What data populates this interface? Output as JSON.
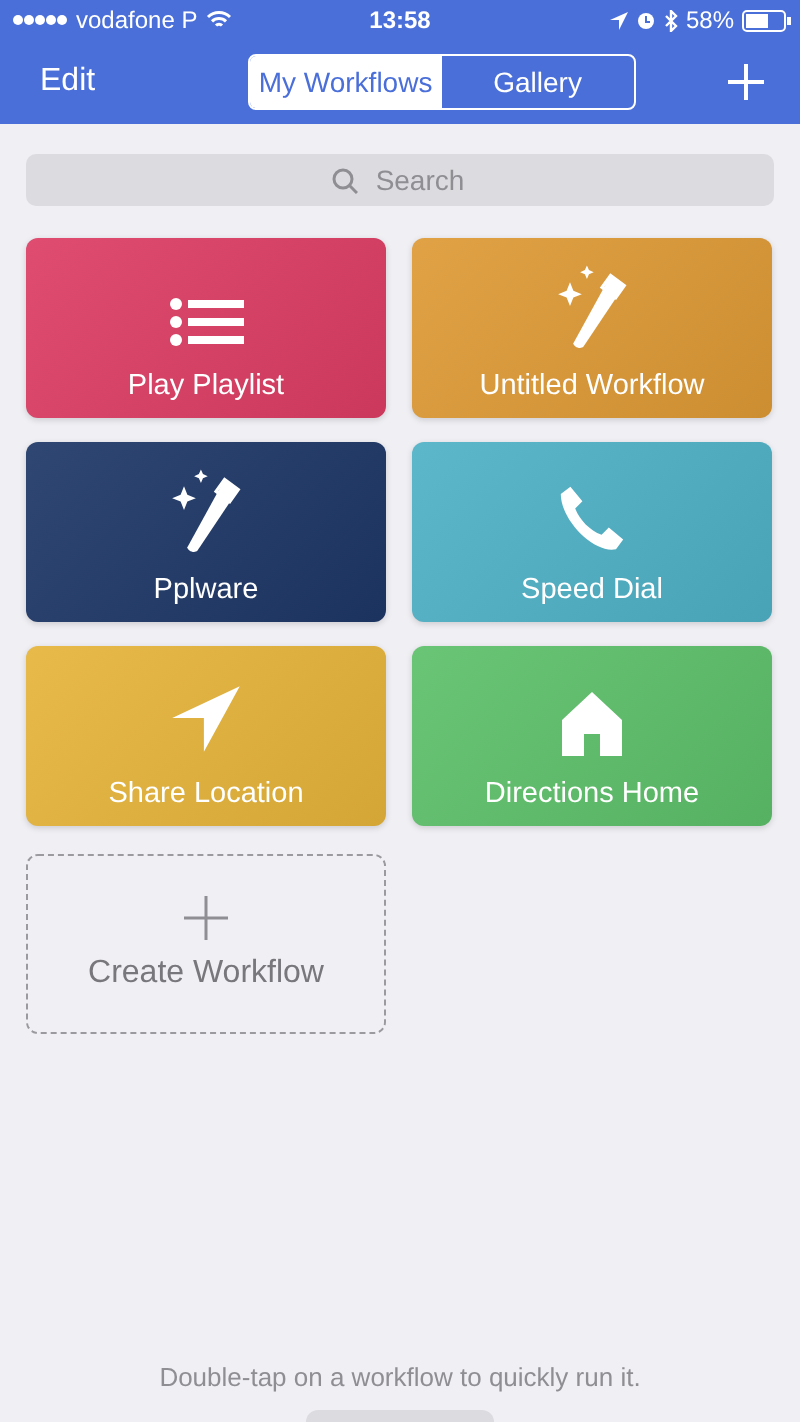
{
  "status_bar": {
    "carrier": "vodafone P",
    "time": "13:58",
    "battery": "58%"
  },
  "nav": {
    "edit": "Edit",
    "tabs": [
      {
        "label": "My Workflows",
        "selected": true
      },
      {
        "label": "Gallery",
        "selected": false
      }
    ]
  },
  "search": {
    "placeholder": "Search"
  },
  "workflows": [
    {
      "name": "Play Playlist",
      "kind": "list",
      "color": "#dc3d64"
    },
    {
      "name": "Untitled Workflow",
      "kind": "wand",
      "color": "#de9a36"
    },
    {
      "name": "Pplware",
      "kind": "wand",
      "color": "#1d3766"
    },
    {
      "name": "Speed Dial",
      "kind": "phone",
      "color": "#4fb1c6"
    },
    {
      "name": "Share Location",
      "kind": "arrow",
      "color": "#e6b43a"
    },
    {
      "name": "Directions Home",
      "kind": "house",
      "color": "#5dc16a"
    }
  ],
  "create": {
    "label": "Create Workflow"
  },
  "hint": "Double-tap on a workflow to quickly run it."
}
